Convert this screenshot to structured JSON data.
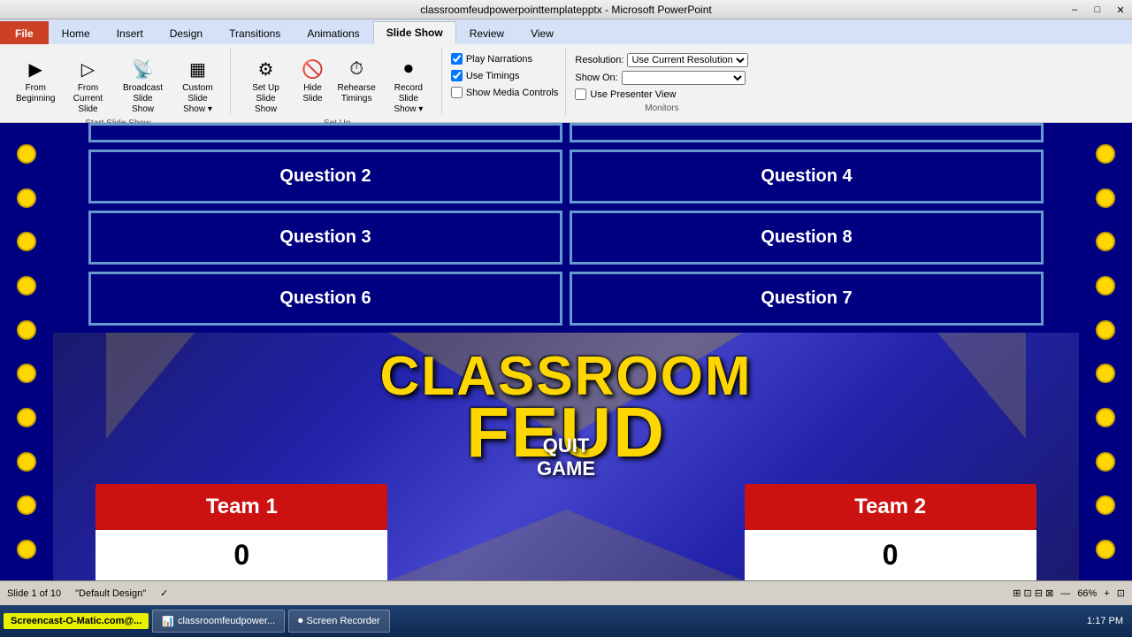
{
  "titlebar": {
    "title": "classroomfeudpowerpointtemplatepptx - Microsoft PowerPoint",
    "min": "–",
    "max": "□",
    "close": "✕"
  },
  "ribbon": {
    "tabs": [
      "File",
      "Home",
      "Insert",
      "Design",
      "Transitions",
      "Animations",
      "Slide Show",
      "Review",
      "View"
    ],
    "active_tab": "Slide Show",
    "groups": {
      "start_slideshow": {
        "label": "Start Slide Show",
        "buttons": [
          {
            "label": "From\nBeginning",
            "icon": "▶"
          },
          {
            "label": "From\nCurrent Slide",
            "icon": "▷"
          },
          {
            "label": "Broadcast\nSlide Show",
            "icon": "📡"
          },
          {
            "label": "Custom\nSlide Show",
            "icon": "▦"
          }
        ]
      },
      "setup": {
        "label": "Set Up",
        "buttons": [
          {
            "label": "Set Up\nSlide Show",
            "icon": "⚙"
          },
          {
            "label": "Hide\nSlide",
            "icon": "🚫"
          },
          {
            "label": "Rehearse\nTimings",
            "icon": "⏱"
          },
          {
            "label": "Record Slide\nShow",
            "icon": "⏺"
          }
        ]
      },
      "media": {
        "checkboxes": [
          {
            "checked": true,
            "label": "Play Narrations"
          },
          {
            "checked": true,
            "label": "Use Timings"
          },
          {
            "checked": false,
            "label": "Show Media Controls"
          }
        ]
      },
      "monitors": {
        "label": "Monitors",
        "resolution_label": "Resolution:",
        "resolution_value": "Use Current Resolution",
        "show_on_label": "Show On:",
        "show_on_value": "",
        "presenter_view": {
          "checked": false,
          "label": "Use Presenter View"
        }
      }
    }
  },
  "slide": {
    "questions": [
      {
        "id": "q1",
        "label": "",
        "partial": true
      },
      {
        "id": "q5",
        "label": "",
        "partial": true
      },
      {
        "id": "q2",
        "label": "Question 2"
      },
      {
        "id": "q6",
        "label": "Question 6"
      },
      {
        "id": "q3",
        "label": "Question 3"
      },
      {
        "id": "q7",
        "label": "Question 7"
      },
      {
        "id": "q4",
        "label": "Question 4"
      },
      {
        "id": "q8",
        "label": "Question 8"
      }
    ],
    "game_title_line1": "CLASSROOM",
    "game_title_line2": "FEUD",
    "team1": {
      "name": "Team 1",
      "score": "0"
    },
    "team2": {
      "name": "Team 2",
      "score": "0"
    },
    "quit_label": "QUIT GAME"
  },
  "statusbar": {
    "slide_info": "Slide 1 of 10",
    "theme": "\"Default Design\"",
    "zoom": "66%",
    "check_icon": "✓"
  },
  "taskbar": {
    "screencast": "Screencast-O-Matic.com@...",
    "ppt_btn": "classroomfeudpower...",
    "recorder_btn": "Screen Recorder",
    "time": "1:17 PM"
  },
  "dots": {
    "count": 10
  }
}
